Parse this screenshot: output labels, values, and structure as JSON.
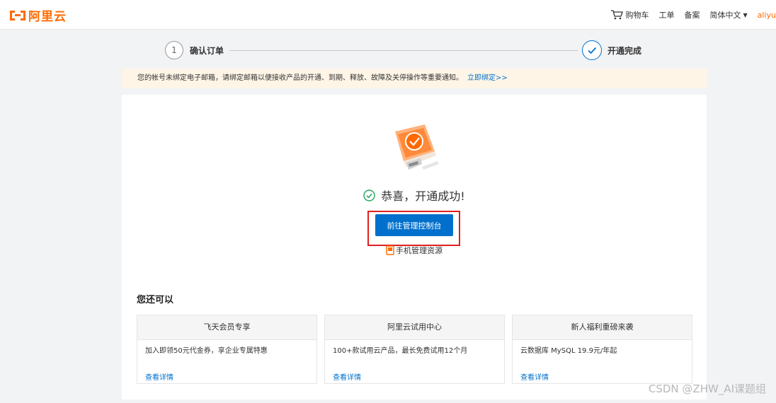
{
  "header": {
    "logo_text": "阿里云",
    "nav": {
      "cart": "购物车",
      "ticket": "工单",
      "filing": "备案",
      "language": "简体中文",
      "user": "aliyu"
    }
  },
  "steps": [
    {
      "number": "1",
      "label": "确认订单"
    },
    {
      "label": "开通完成"
    }
  ],
  "notice": {
    "text": "您的帐号未绑定电子邮箱，请绑定邮箱以便接收产品的开通、到期、释放、故障及关停操作等重要通知。",
    "link": "立即绑定>>"
  },
  "result": {
    "message": "恭喜，开通成功!",
    "button": "前往管理控制台",
    "mobile_link": "手机管理资源"
  },
  "more": {
    "title": "您还可以",
    "cards": [
      {
        "title": "飞天会员专享",
        "desc": "加入即领50元代金券，享企业专属特惠",
        "link": "查看详情"
      },
      {
        "title": "阿里云试用中心",
        "desc": "100+款试用云产品，最长免费试用12个月",
        "link": "查看详情"
      },
      {
        "title": "新人福利重磅来袭",
        "desc": "云数据库 MySQL 19.9元/年起",
        "link": "查看详情"
      }
    ]
  },
  "watermark": "CSDN @ZHW_AI课题组",
  "colors": {
    "brand": "#ff6a00",
    "primary": "#0070cc",
    "highlight": "#e02020",
    "notice_bg": "#fef5e7"
  }
}
